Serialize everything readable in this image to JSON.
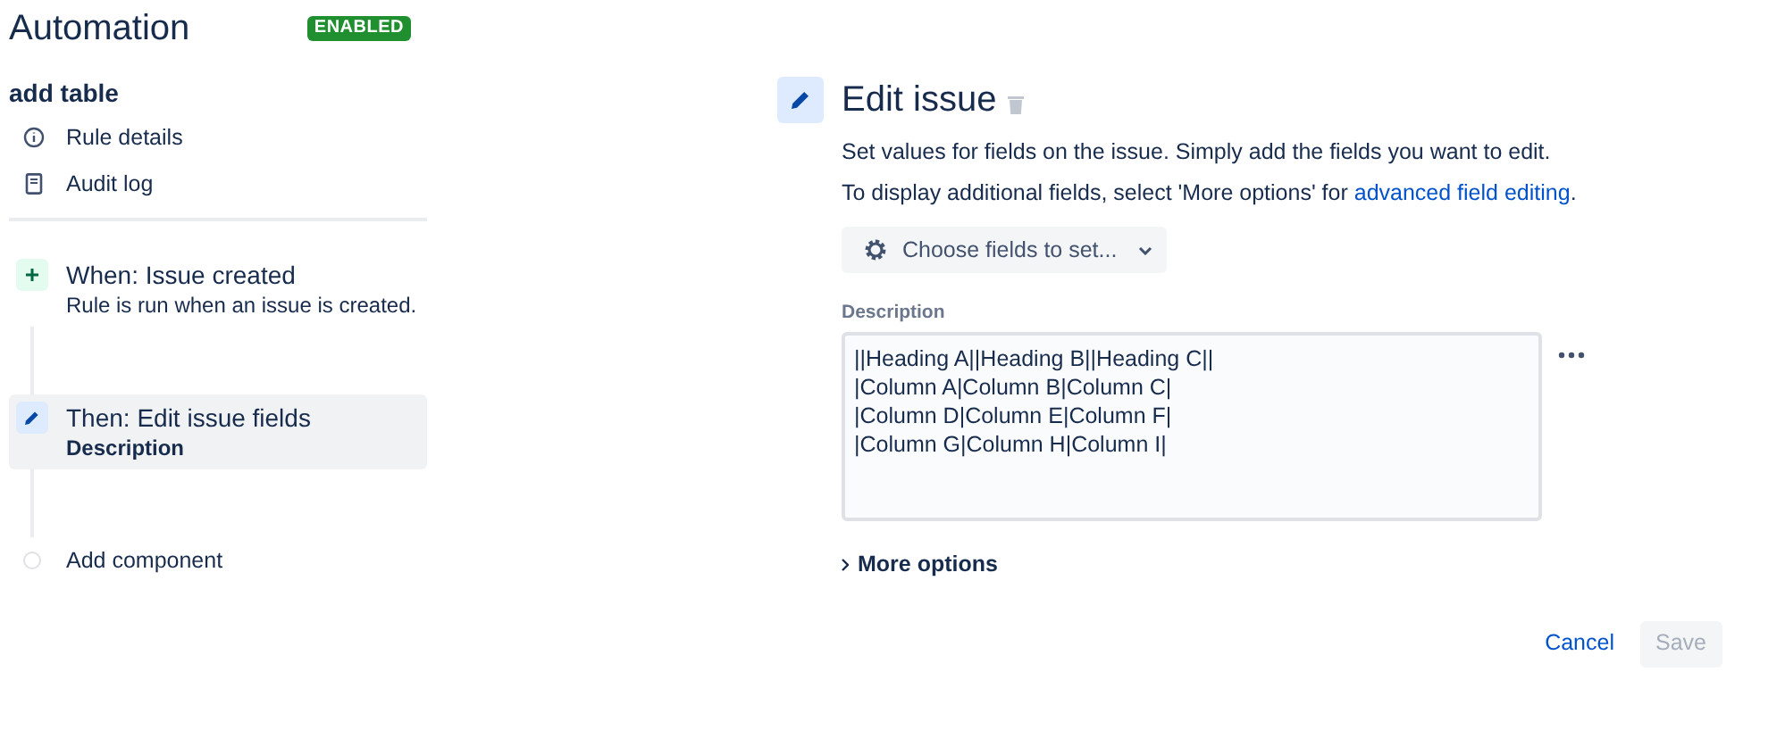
{
  "header": {
    "title": "Automation",
    "badge": "ENABLED"
  },
  "rule": {
    "name": "add table",
    "links": [
      {
        "kind": "info",
        "label": "Rule details"
      },
      {
        "kind": "log",
        "label": "Audit log"
      }
    ]
  },
  "steps": [
    {
      "kind": "trigger",
      "title": "When: Issue created",
      "subtitle": "Rule is run when an issue is created.",
      "selected": false
    },
    {
      "kind": "action",
      "title": "Then: Edit issue fields",
      "subtitle": "Description",
      "selected": true
    },
    {
      "kind": "add",
      "title": "Add component",
      "selected": false
    }
  ],
  "panel": {
    "title": "Edit issue",
    "intro": "Set values for fields on the issue. Simply add the fields you want to edit.",
    "hint": "To display additional fields, select 'More options' for ",
    "hint_link": "advanced field editing",
    "hint_end": ".",
    "choose_button": "Choose fields to set...",
    "field_label": "Description",
    "field_value": "||Heading A||Heading B||Heading C||\n|Column A|Column B|Column C|\n|Column D|Column E|Column F|\n|Column G|Column H|Column I|",
    "more_options": "More options",
    "cancel": "Cancel",
    "save": "Save",
    "save_disabled": true
  }
}
